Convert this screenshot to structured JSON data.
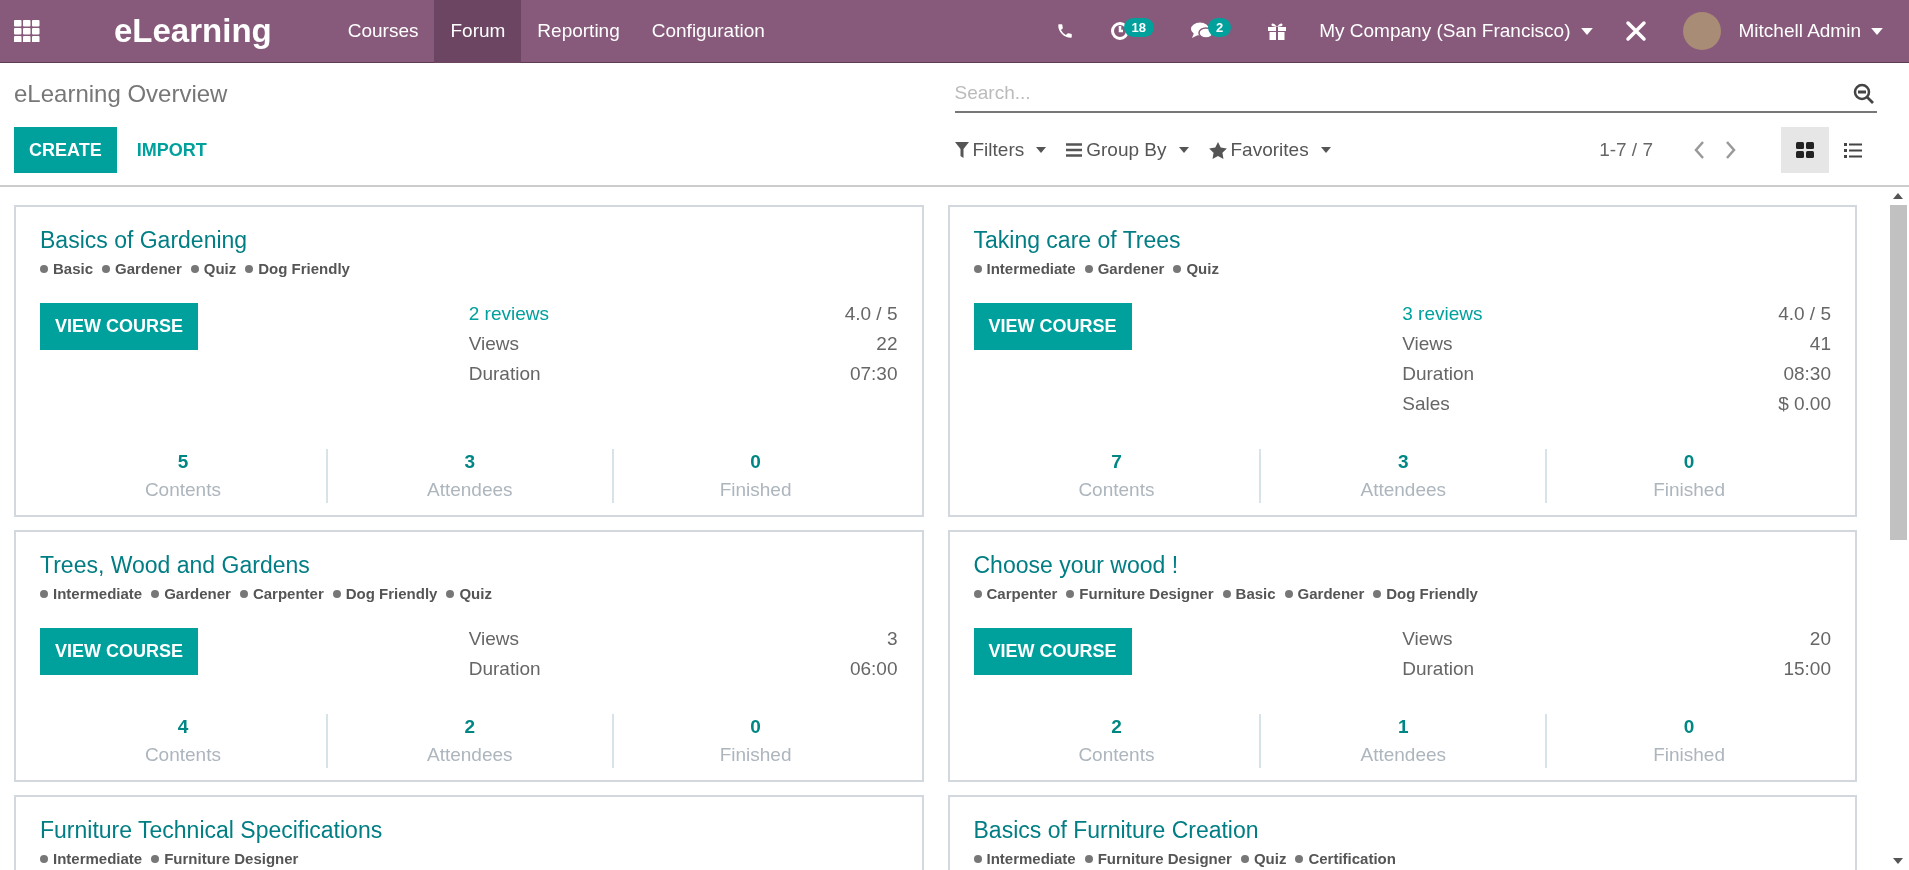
{
  "topbar": {
    "brand": "eLearning",
    "menu": [
      {
        "label": "Courses",
        "selected": false
      },
      {
        "label": "Forum",
        "selected": true
      },
      {
        "label": "Reporting",
        "selected": false
      },
      {
        "label": "Configuration",
        "selected": false
      }
    ],
    "activity_count": "18",
    "message_count": "2",
    "company": "My Company (San Francisco)",
    "user": "Mitchell Admin"
  },
  "control_panel": {
    "title": "eLearning Overview",
    "buttons": [
      "CREATE",
      "IMPORT"
    ],
    "search": {
      "placeholder": "Search..."
    },
    "filters": [
      "Filters",
      "Group By",
      "Favorites"
    ],
    "pager": "1-7 / 7",
    "views": [
      {
        "kind": "kanban",
        "selected": true
      },
      {
        "kind": "list",
        "selected": false
      }
    ]
  },
  "courses": [
    {
      "title": "Basics of Gardening",
      "tags": [
        "Basic",
        "Gardener",
        "Quiz",
        "Dog Friendly"
      ],
      "button": "VIEW COURSE",
      "info": [
        {
          "kind": "link",
          "label": "2 reviews",
          "value": "4.0 / 5"
        },
        {
          "kind": "plain",
          "label": "Views",
          "value": "22"
        },
        {
          "kind": "plain",
          "label": "Duration",
          "value": "07:30"
        }
      ],
      "stats": [
        {
          "value": "5",
          "label": "Contents"
        },
        {
          "value": "3",
          "label": "Attendees"
        },
        {
          "value": "0",
          "label": "Finished"
        }
      ]
    },
    {
      "title": "Taking care of Trees",
      "tags": [
        "Intermediate",
        "Gardener",
        "Quiz"
      ],
      "button": "VIEW COURSE",
      "info": [
        {
          "kind": "link",
          "label": "3 reviews",
          "value": "4.0 / 5"
        },
        {
          "kind": "plain",
          "label": "Views",
          "value": "41"
        },
        {
          "kind": "plain",
          "label": "Duration",
          "value": "08:30"
        },
        {
          "kind": "plain",
          "label": "Sales",
          "value": "$ 0.00"
        }
      ],
      "stats": [
        {
          "value": "7",
          "label": "Contents"
        },
        {
          "value": "3",
          "label": "Attendees"
        },
        {
          "value": "0",
          "label": "Finished"
        }
      ]
    },
    {
      "title": "Trees, Wood and Gardens",
      "tags": [
        "Intermediate",
        "Gardener",
        "Carpenter",
        "Dog Friendly",
        "Quiz"
      ],
      "button": "VIEW COURSE",
      "info": [
        {
          "kind": "plain",
          "label": "Views",
          "value": "3"
        },
        {
          "kind": "plain",
          "label": "Duration",
          "value": "06:00"
        }
      ],
      "stats": [
        {
          "value": "4",
          "label": "Contents"
        },
        {
          "value": "2",
          "label": "Attendees"
        },
        {
          "value": "0",
          "label": "Finished"
        }
      ]
    },
    {
      "title": "Choose your wood !",
      "tags": [
        "Carpenter",
        "Furniture Designer",
        "Basic",
        "Gardener",
        "Dog Friendly"
      ],
      "button": "VIEW COURSE",
      "info": [
        {
          "kind": "plain",
          "label": "Views",
          "value": "20"
        },
        {
          "kind": "plain",
          "label": "Duration",
          "value": "15:00"
        }
      ],
      "stats": [
        {
          "value": "2",
          "label": "Contents"
        },
        {
          "value": "1",
          "label": "Attendees"
        },
        {
          "value": "0",
          "label": "Finished"
        }
      ]
    },
    {
      "title": "Furniture Technical Specifications",
      "tags": [
        "Intermediate",
        "Furniture Designer"
      ]
    },
    {
      "title": "Basics of Furniture Creation",
      "tags": [
        "Intermediate",
        "Furniture Designer",
        "Quiz",
        "Certification"
      ]
    }
  ]
}
